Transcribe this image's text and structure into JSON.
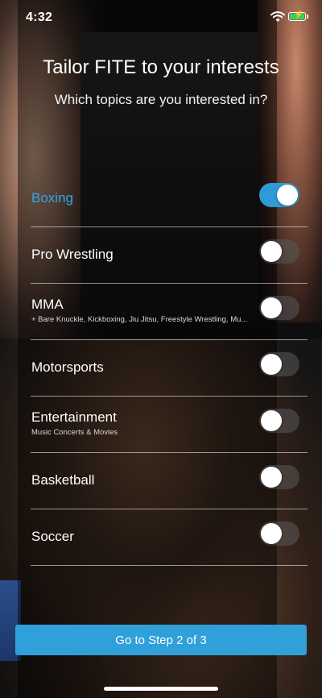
{
  "status_bar": {
    "time": "4:32",
    "battery_color": "#33d15b"
  },
  "header": {
    "title": "Tailor FITE to your interests",
    "subtitle": "Which topics are you interested in?"
  },
  "topics": [
    {
      "name": "Boxing",
      "subtitle": "",
      "enabled": true
    },
    {
      "name": "Pro Wrestling",
      "subtitle": "",
      "enabled": false
    },
    {
      "name": "MMA",
      "subtitle": "+ Bare Knuckle, Kickboxing, Jiu Jitsu, Freestyle Wrestling, Mu...",
      "enabled": false
    },
    {
      "name": "Motorsports",
      "subtitle": "",
      "enabled": false
    },
    {
      "name": "Entertainment",
      "subtitle": "Music Concerts & Movies",
      "enabled": false
    },
    {
      "name": "Basketball",
      "subtitle": "",
      "enabled": false
    },
    {
      "name": "Soccer",
      "subtitle": "",
      "enabled": false
    }
  ],
  "cta": {
    "label": "Go to Step 2 of 3"
  },
  "colors": {
    "accent": "#2f9ad8",
    "selected_text": "#35a6e4"
  }
}
